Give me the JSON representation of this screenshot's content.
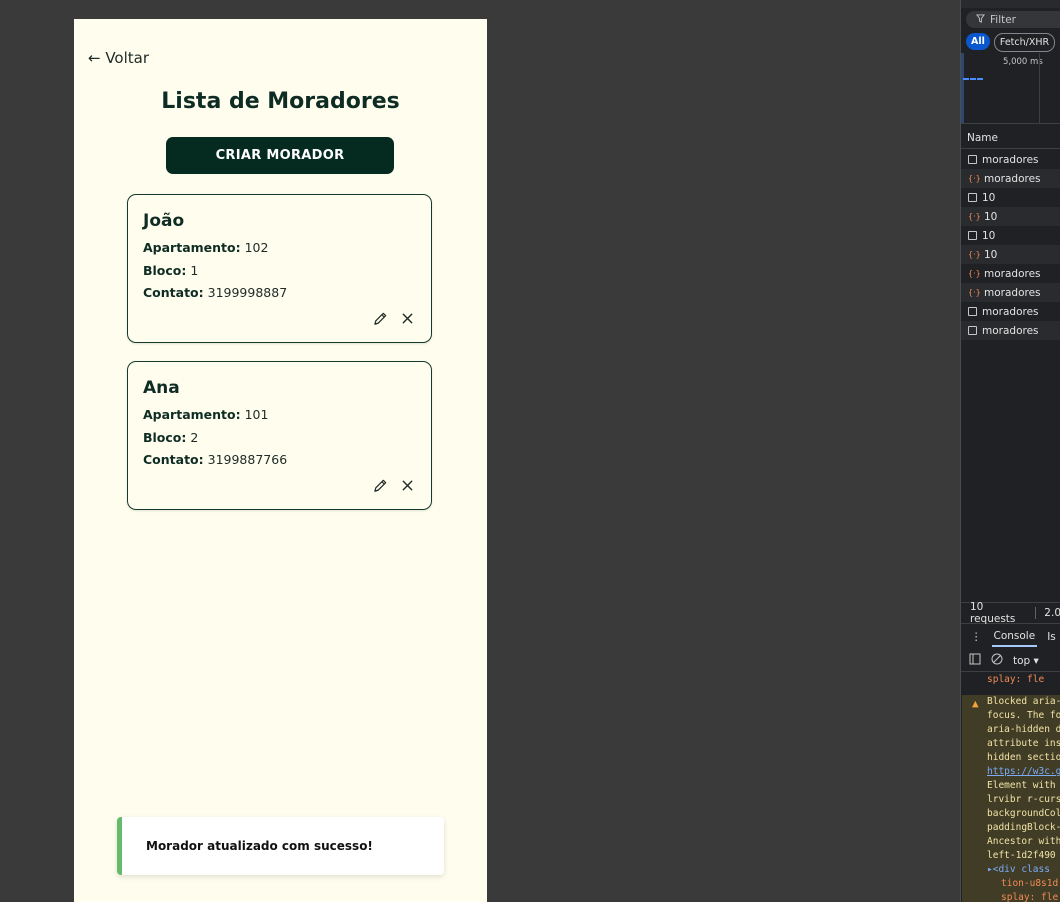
{
  "app": {
    "back_label": "← Voltar",
    "title": "Lista de Moradores",
    "create_button": "CRIAR MORADOR",
    "labels": {
      "apartment": "Apartamento:",
      "block": "Bloco:",
      "contact": "Contato:"
    },
    "residents": [
      {
        "name": "João",
        "apartment": "102",
        "block": "1",
        "contact": "3199998887"
      },
      {
        "name": "Ana",
        "apartment": "101",
        "block": "2",
        "contact": "3199887766"
      }
    ],
    "icons": {
      "edit": "pencil-icon",
      "delete": "close-icon"
    },
    "toast": {
      "message": "Morador atualizado com sucesso!",
      "accent": "#66bb6a"
    }
  },
  "devtools": {
    "filter_placeholder": "Filter",
    "filters": [
      "All",
      "Fetch/XHR"
    ],
    "timeline_label": "5,000 ms",
    "column_name": "Name",
    "requests": [
      {
        "name": "moradores",
        "type": "doc"
      },
      {
        "name": "moradores",
        "type": "json"
      },
      {
        "name": "10",
        "type": "doc"
      },
      {
        "name": "10",
        "type": "json"
      },
      {
        "name": "10",
        "type": "doc"
      },
      {
        "name": "10",
        "type": "json"
      },
      {
        "name": "moradores",
        "type": "json"
      },
      {
        "name": "moradores",
        "type": "json"
      },
      {
        "name": "moradores",
        "type": "doc"
      },
      {
        "name": "moradores",
        "type": "doc"
      }
    ],
    "status_requests": "10 requests",
    "status_size": "2.0",
    "tab_console": "Console",
    "tab_other": "Is",
    "context": "top ▾",
    "console_prev": "splay: fle",
    "console_warning": [
      "Blocked aria-",
      "focus. The fo",
      "aria-hidden d",
      "attribute ins",
      "hidden sectio",
      "https://w3c.g",
      "Element with",
      "lrvibr r-curs",
      "backgroundCol",
      "paddingBlock-",
      "Ancestor with",
      "left-1d2f490",
      "▸<div class",
      "tion-u8s1d",
      "splay: fle"
    ]
  }
}
